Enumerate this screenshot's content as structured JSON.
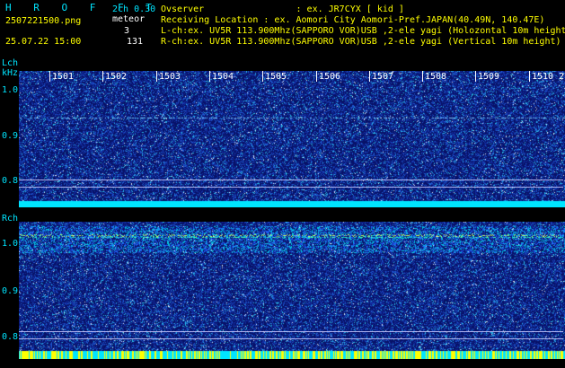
{
  "header": {
    "app_title": "H R O F F T",
    "file_name": "2507221500.png",
    "datetime": "25.07.22 15:00",
    "channels": "2ch 0.30",
    "meteor_label": "meteor",
    "meteor_l": "3",
    "meteor_r": "131"
  },
  "station": {
    "observer": "Ovserver                 : ex. JR7CYX [ kid ]",
    "location": "Receiving Location : ex. Aomori City Aomori-Pref.JAPAN(40.49N, 140.47E)",
    "lch": "L-ch:ex. UV5R 113.900Mhz(SAPPORO VOR)USB ,2-ele yagi (Holozontal 10m height",
    "rch": "R-ch:ex. UV5R 113.900Mhz(SAPPORO VOR)USB ,2-ele yagi (Vertical 10m height)"
  },
  "left_axis": {
    "lch_label": "Lch",
    "unit": "kHz",
    "lch_ticks": [
      "1.0",
      "0.9",
      "0.8"
    ],
    "rch_label": "Rch",
    "rch_ticks": [
      "1.0",
      "0.9",
      "0.8"
    ]
  },
  "minutes": [
    "1501",
    "1502",
    "1503",
    "1504",
    "1505",
    "1506",
    "1507",
    "1508",
    "1509",
    "1510"
  ],
  "edge_marker": "2",
  "colors": {
    "cyan": "#00e5ff",
    "yellow": "#ffff00",
    "waterfall_bg": "#0a1a8c",
    "waterfall_noise": "#3a7bff"
  }
}
